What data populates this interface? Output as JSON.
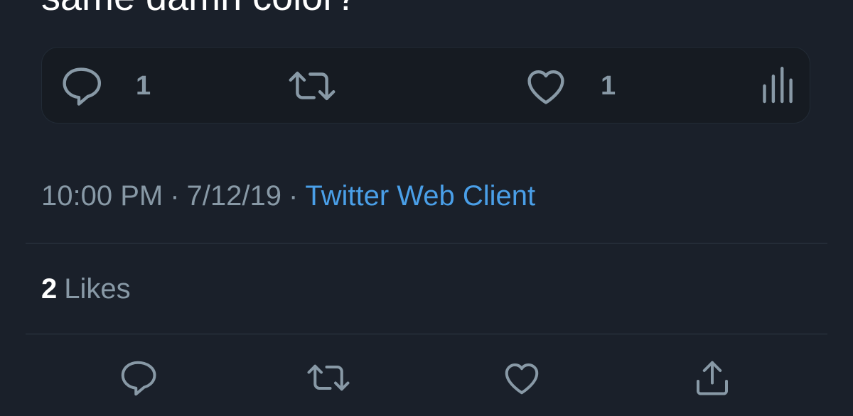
{
  "tweet": {
    "text_partial": "same damn color?"
  },
  "quoted_actions": {
    "reply_count": "1",
    "like_count": "1",
    "icons": [
      "reply-icon",
      "retweet-icon",
      "like-icon",
      "analytics-icon"
    ]
  },
  "meta": {
    "time": "10:00 PM",
    "separator": "·",
    "date": "7/12/19",
    "source": "Twitter Web Client"
  },
  "stats": {
    "likes_count": "2",
    "likes_label": "Likes"
  },
  "action_bar": {
    "icons": [
      "reply-icon",
      "retweet-icon",
      "like-icon",
      "share-icon"
    ]
  },
  "colors": {
    "background": "#1a202a",
    "text_primary": "#ffffff",
    "text_secondary": "#8899a6",
    "link": "#4a9fe8",
    "divider": "#2f3945"
  }
}
